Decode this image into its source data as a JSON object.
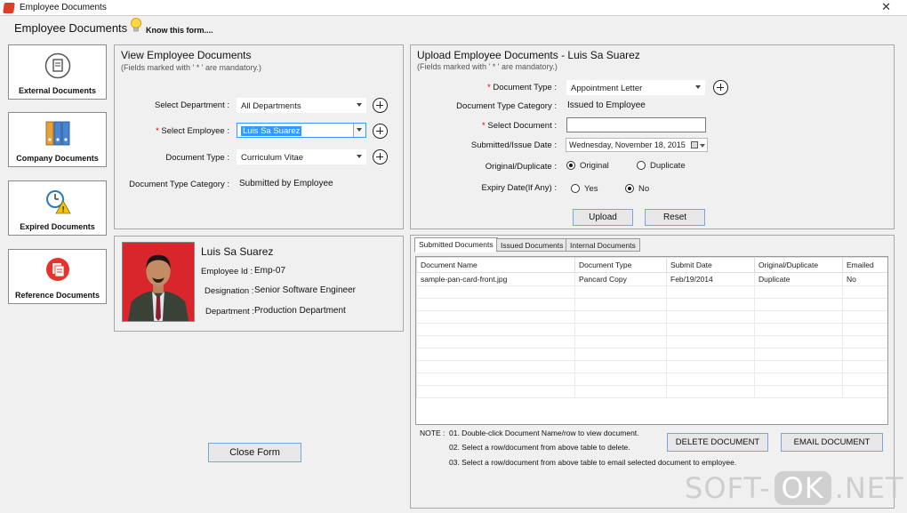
{
  "window": {
    "title": "Employee Documents",
    "close_label": "✕"
  },
  "header": {
    "title": "Employee Documents",
    "help_link": "Know this form....",
    "help_icon": "lightbulb-icon"
  },
  "sidebar": {
    "items": [
      {
        "label": "External Documents",
        "icon": "document-icon"
      },
      {
        "label": "Company Documents",
        "icon": "binders-icon"
      },
      {
        "label": "Expired Documents",
        "icon": "clock-warning-icon"
      },
      {
        "label": "Reference Documents",
        "icon": "pages-icon"
      }
    ]
  },
  "view_panel": {
    "title": "View Employee Documents",
    "subtitle": "(Fields marked with ' * ' are mandatory.)",
    "department_label": "Select Department :",
    "department_value": "All Departments",
    "employee_label": "Select Employee :",
    "employee_value": "Luis Sa Suarez",
    "doc_type_label": "Document Type :",
    "doc_type_value": "Curriculum Vitae",
    "doc_category_label": "Document Type Category :",
    "doc_category_value": "Submitted by Employee",
    "asterisk": "*"
  },
  "employee_card": {
    "name": "Luis Sa Suarez",
    "id_label": "Employee Id :",
    "id_value": "Emp-07",
    "designation_label": "Designation :",
    "designation_value": "Senior Software Engineer",
    "department_label": "Department :",
    "department_value": "Production Department"
  },
  "upload_panel": {
    "title": "Upload Employee Documents - Luis Sa Suarez",
    "subtitle": "(Fields marked with ' * ' are mandatory.)",
    "doc_type_label": "Document Type :",
    "doc_type_value": "Appointment Letter",
    "doc_category_label": "Document Type Category :",
    "doc_category_value": "Issued to Employee",
    "select_doc_label": "Select Document :",
    "select_doc_value": "",
    "date_label": "Submitted/Issue Date :",
    "date_value": "Wednesday, November 18, 2015",
    "orig_dup_label": "Original/Duplicate :",
    "original_label": "Original",
    "duplicate_label": "Duplicate",
    "expiry_label": "Expiry Date(If Any) :",
    "yes_label": "Yes",
    "no_label": "No",
    "upload_button": "Upload",
    "reset_button": "Reset"
  },
  "tabs": [
    "Submitted Documents",
    "Issued Documents",
    "Internal Documents"
  ],
  "table": {
    "columns": [
      "Document Name",
      "Document Type",
      "Submit Date",
      "Original/Duplicate",
      "Emailed"
    ],
    "rows": [
      [
        "sample-pan-card-front.jpg",
        "Pancard Copy",
        "Feb/19/2014",
        "Duplicate",
        "No"
      ]
    ]
  },
  "notes": {
    "prefix": "NOTE :",
    "line1": "01. Double-click Document Name/row to view document.",
    "line2": "02. Select a row/document from above table to delete.",
    "line3": "03. Select a row/document from above table to email selected document to employee."
  },
  "actions": {
    "delete": "DELETE DOCUMENT",
    "email": "EMAIL DOCUMENT",
    "close_form": "Close Form"
  },
  "watermark": {
    "left": "SOFT-",
    "mid": "OK",
    "right": ".NET"
  },
  "colors": {
    "selection": "#3399ff",
    "required": "#dd0000",
    "button_border": "#7aa6d8"
  }
}
